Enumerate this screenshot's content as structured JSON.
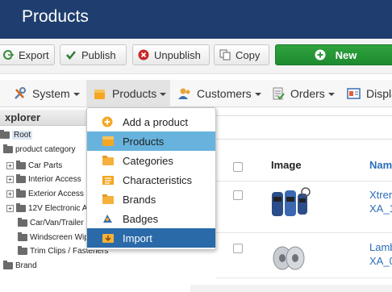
{
  "title": "Products",
  "toolbar": {
    "export": "Export",
    "publish": "Publish",
    "unpublish": "Unpublish",
    "copy": "Copy",
    "new": "New"
  },
  "menu": {
    "system": "System",
    "products": "Products",
    "customers": "Customers",
    "orders": "Orders",
    "display": "Displa"
  },
  "dropdown": {
    "items": [
      "Add a product",
      "Products",
      "Categories",
      "Characteristics",
      "Brands",
      "Badges",
      "Import"
    ],
    "hover_index": 1,
    "active_index": 6
  },
  "explorer": {
    "title": "xplorer",
    "root": "Root",
    "product_category": "product category",
    "children": [
      "Car Parts",
      "Interior Access",
      "Exterior Access",
      "12V Electronic A",
      "Car/Van/Trailer",
      "Windscreen Wip",
      "Trim Clips / Fasteners"
    ],
    "brand": "Brand"
  },
  "grid": {
    "columns": {
      "image": "Image",
      "name": "Nam"
    },
    "rows": [
      {
        "name_line1": "Xtrer",
        "name_line2": "XA_1"
      },
      {
        "name_line1": "Lamb",
        "name_line2": "XA_0"
      }
    ]
  },
  "colors": {
    "title_bar": "#1f3e6f",
    "new_button": "#2fa33e",
    "menu_hover": "#67b3dd",
    "menu_active": "#2a6aa8",
    "link": "#2c6eb5"
  }
}
